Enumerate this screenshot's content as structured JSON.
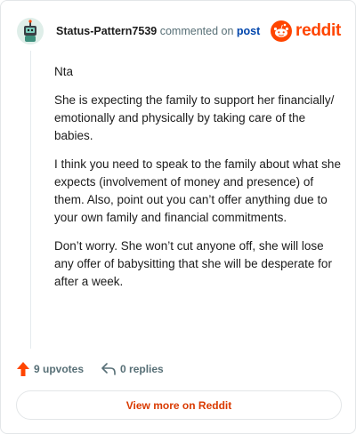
{
  "header": {
    "username": "Status-Pattern7539",
    "commented_on": "commented on",
    "post_link": "post",
    "brand": "reddit"
  },
  "comment": {
    "paragraphs": [
      "Nta",
      "She is expecting the family to support her financially/ emotionally and physically by taking care of the babies.",
      "I think you need to speak to the family about what she expects (involvement of money and presence) of them. Also, point out you can’t offer anything due to your own family and financial commitments.",
      "Don’t worry. She won’t cut anyone off, she will lose any offer of babysitting that she will be desperate for after a week."
    ]
  },
  "actions": {
    "upvotes": "9 upvotes",
    "replies": "0 replies"
  },
  "footer": {
    "view_more": "View more on Reddit"
  },
  "colors": {
    "accent": "#ff4500",
    "link": "#0045ac",
    "muted": "#576f76",
    "view_more": "#d93a00"
  },
  "icons": [
    "avatar-snoo",
    "reddit-logo-icon",
    "upvote-arrow-icon",
    "reply-arrow-icon"
  ]
}
